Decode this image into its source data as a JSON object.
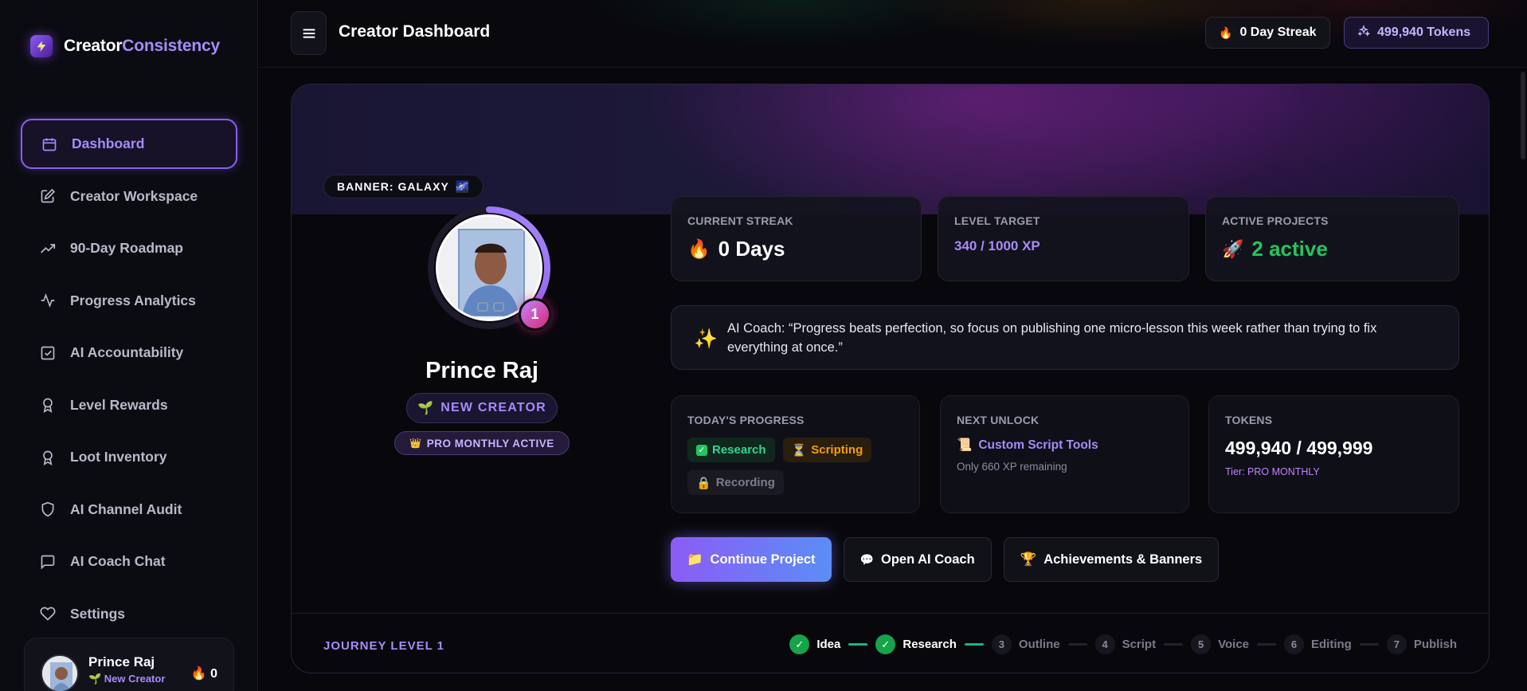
{
  "brand": {
    "part1": "Creator",
    "part2": "Consistency",
    "icon": "lightning-icon"
  },
  "sidebar": {
    "items": [
      {
        "label": "Dashboard",
        "icon": "calendar-icon",
        "active": true
      },
      {
        "label": "Creator Workspace",
        "icon": "edit-icon"
      },
      {
        "label": "90-Day Roadmap",
        "icon": "trend-icon"
      },
      {
        "label": "Progress Analytics",
        "icon": "pulse-icon"
      },
      {
        "label": "AI Accountability",
        "icon": "check-square-icon"
      },
      {
        "label": "Level Rewards",
        "icon": "award-icon"
      },
      {
        "label": "Loot Inventory",
        "icon": "award-icon"
      },
      {
        "label": "AI Channel Audit",
        "icon": "shield-icon"
      },
      {
        "label": "AI Coach Chat",
        "icon": "chat-icon"
      },
      {
        "label": "Settings",
        "icon": "heart-icon"
      }
    ],
    "user": {
      "name": "Prince Raj",
      "title": "🌱 New Creator",
      "streak": "0"
    }
  },
  "header": {
    "title": "Creator Dashboard",
    "streak": "0 Day Streak",
    "tokens": "499,940 Tokens"
  },
  "profile": {
    "banner_tag": "BANNER: GALAXY",
    "level": "1",
    "name": "Prince Raj",
    "rank": "NEW CREATOR",
    "plan": "PRO MONTHLY ACTIVE",
    "level_progress": 0.34
  },
  "stats": {
    "streak": {
      "label": "CURRENT STREAK",
      "value": "0 Days"
    },
    "level": {
      "label": "LEVEL TARGET",
      "value": "340 / 1000 XP"
    },
    "projects": {
      "label": "ACTIVE PROJECTS",
      "value": "2 active"
    }
  },
  "coach": {
    "text": "AI Coach: “Progress beats perfection, so focus on publishing one micro-lesson this week rather than trying to fix everything at once.”"
  },
  "progress": {
    "label": "TODAY'S PROGRESS",
    "chips": [
      {
        "label": "Research",
        "state": "done"
      },
      {
        "label": "Scripting",
        "state": "active"
      },
      {
        "label": "Recording",
        "state": "locked"
      }
    ]
  },
  "unlock": {
    "label": "NEXT UNLOCK",
    "item": "Custom Script Tools",
    "sub": "Only 660 XP remaining"
  },
  "tokens": {
    "label": "TOKENS",
    "value": "499,940 / 499,999",
    "tier": "Tier: PRO MONTHLY"
  },
  "actions": {
    "continue": "Continue Project",
    "coach": "Open AI Coach",
    "achievements": "Achievements & Banners"
  },
  "journey": {
    "label": "JOURNEY LEVEL 1",
    "steps": [
      {
        "num": "✓",
        "label": "Idea",
        "done": true
      },
      {
        "num": "✓",
        "label": "Research",
        "done": true
      },
      {
        "num": "3",
        "label": "Outline",
        "done": false
      },
      {
        "num": "4",
        "label": "Script",
        "done": false
      },
      {
        "num": "5",
        "label": "Voice",
        "done": false
      },
      {
        "num": "6",
        "label": "Editing",
        "done": false
      },
      {
        "num": "7",
        "label": "Publish",
        "done": false
      }
    ]
  },
  "colors": {
    "accent": "#8b5cf6",
    "accent_light": "#a78bfa",
    "success": "#22c55e",
    "warning": "#f59e0b"
  }
}
